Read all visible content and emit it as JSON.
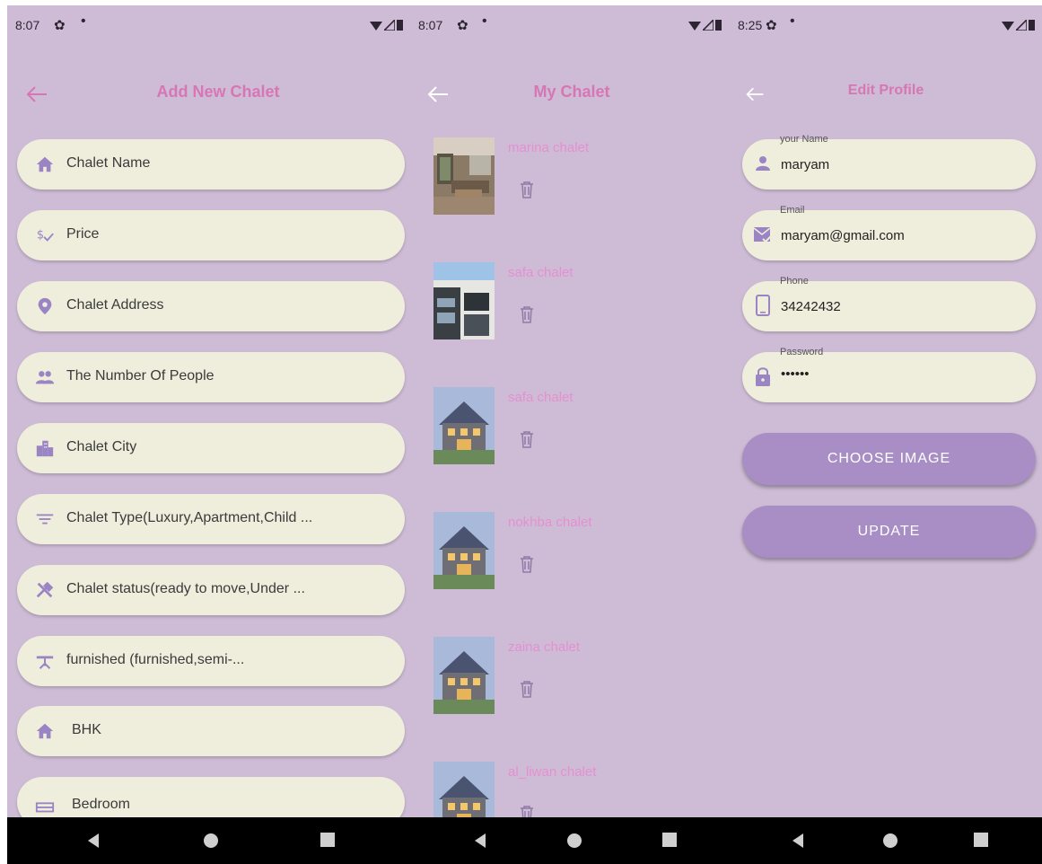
{
  "screens": {
    "add_chalet": {
      "status": {
        "time": "8:07"
      },
      "title": "Add New Chalet",
      "fields": [
        {
          "label": "Chalet Name",
          "icon": "home-icon"
        },
        {
          "label": "Price",
          "icon": "price-icon"
        },
        {
          "label": "Chalet Address",
          "icon": "location-pin-icon"
        },
        {
          "label": "The Number Of People",
          "icon": "people-icon"
        },
        {
          "label": "Chalet City",
          "icon": "city-icon"
        },
        {
          "label": "Chalet Type(Luxury,Apartment,Child ...",
          "icon": "filter-icon"
        },
        {
          "label": "Chalet status(ready to move,Under ...",
          "icon": "tools-icon"
        },
        {
          "label": "furnished (furnished,semi-...",
          "icon": "table-icon"
        },
        {
          "label": "BHK",
          "icon": "home-icon"
        },
        {
          "label": "Bedroom",
          "icon": "bed-icon"
        }
      ]
    },
    "my_chalet": {
      "status": {
        "time": "8:07"
      },
      "title": "My Chalet",
      "items": [
        {
          "name": "marina chalet",
          "thumb": "living-room"
        },
        {
          "name": "safa chalet",
          "thumb": "modern-building"
        },
        {
          "name": "safa chalet",
          "thumb": "house"
        },
        {
          "name": "nokhba chalet",
          "thumb": "house"
        },
        {
          "name": "zaina chalet",
          "thumb": "house"
        },
        {
          "name": "al_liwan chalet",
          "thumb": "house"
        }
      ]
    },
    "edit_profile": {
      "status": {
        "time": "8:25"
      },
      "title": "Edit Profile",
      "fields": [
        {
          "label": "your Name",
          "value": "maryam",
          "icon": "person-icon"
        },
        {
          "label": "Email",
          "value": "maryam@gmail.com",
          "icon": "mail-check-icon"
        },
        {
          "label": "Phone",
          "value": "34242432",
          "icon": "phone-icon"
        },
        {
          "label": "Password",
          "value": "••••••",
          "icon": "lock-icon"
        }
      ],
      "buttons": {
        "choose_image": "CHOOSE IMAGE",
        "update": "UPDATE"
      }
    }
  },
  "colors": {
    "background": "#cebcd6",
    "field": "#efeddc",
    "accent": "#d776b4",
    "icon": "#9b84c4",
    "button": "#a98ec6"
  }
}
